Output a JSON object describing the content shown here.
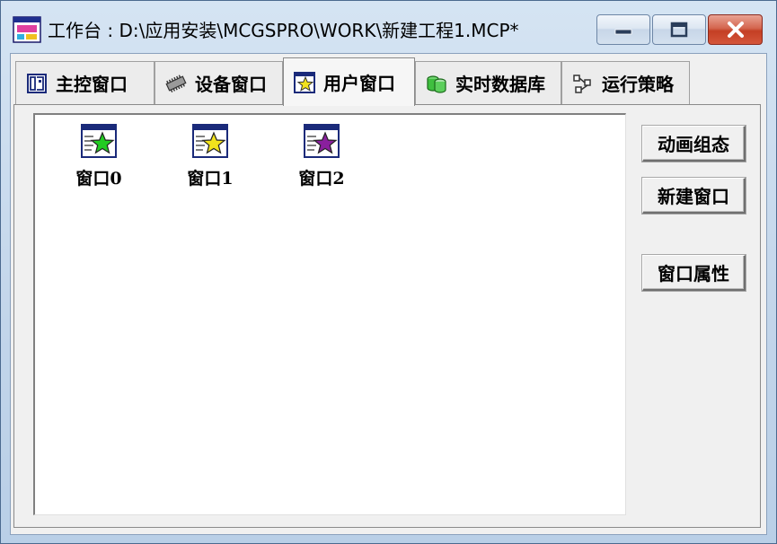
{
  "window": {
    "title": "工作台 : D:\\应用安装\\MCGSPRO\\WORK\\新建工程1.MCP*",
    "caption_buttons": {
      "minimize": "minimize-icon",
      "maximize": "maximize-icon",
      "close": "close-icon"
    }
  },
  "tabs": [
    {
      "label": "主控窗口",
      "icon": "main-window-icon",
      "active": false
    },
    {
      "label": "设备窗口",
      "icon": "device-chip-icon",
      "active": false
    },
    {
      "label": "用户窗口",
      "icon": "user-window-star-icon",
      "active": true
    },
    {
      "label": "实时数据库",
      "icon": "database-icon",
      "active": false
    },
    {
      "label": "运行策略",
      "icon": "strategy-icon",
      "active": false
    }
  ],
  "windows_list": [
    {
      "label": "窗口0",
      "icon": "window-green-star-icon",
      "star_color": "#22cc22"
    },
    {
      "label": "窗口1",
      "icon": "window-yellow-star-icon",
      "star_color": "#f2e21c"
    },
    {
      "label": "窗口2",
      "icon": "window-purple-star-icon",
      "star_color": "#8a1f9e"
    }
  ],
  "side_buttons": {
    "animation_config": "动画组态",
    "new_window": "新建窗口",
    "window_properties": "窗口属性"
  },
  "colors": {
    "title_bar": "#c7d9ec",
    "close_button": "#c43f24",
    "panel_bg": "#f0f0f0"
  }
}
